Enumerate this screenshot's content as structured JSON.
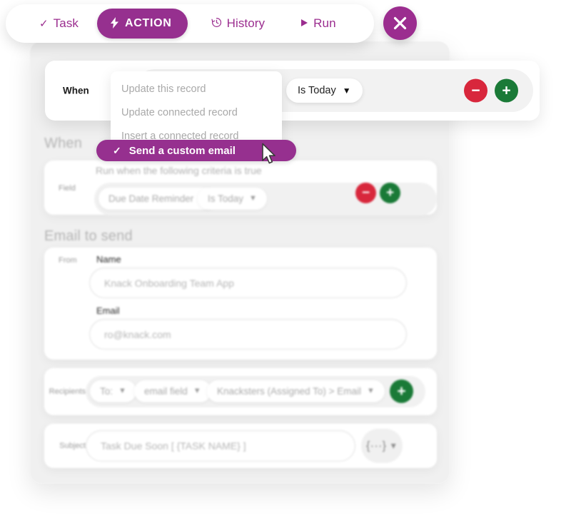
{
  "tabs": [
    {
      "label": "Task",
      "icon": "check-icon",
      "glyph": "✓",
      "active": false
    },
    {
      "label": "ACTION",
      "icon": "bolt-icon",
      "glyph": "⚡",
      "active": true
    },
    {
      "label": "History",
      "icon": "clock-icon",
      "glyph": "↺",
      "active": false
    },
    {
      "label": "Run",
      "icon": "play-icon",
      "glyph": "▶",
      "active": false
    }
  ],
  "close_button": {
    "icon": "close-icon",
    "label": "×"
  },
  "when_card": {
    "label": "When",
    "condition_pill": {
      "label": "Is Today",
      "icon": "chevron-down-icon",
      "caret": "▼"
    },
    "remove_button": {
      "icon": "minus-circle-icon",
      "glyph": "−",
      "color": "#d8273c"
    },
    "add_button": {
      "icon": "plus-circle-icon",
      "glyph": "+",
      "color": "#1a7a37"
    }
  },
  "dropdown": {
    "items": [
      {
        "label": "Update this record",
        "selected": false
      },
      {
        "label": "Update connected record",
        "selected": false
      },
      {
        "label": "Insert a connected record",
        "selected": false
      }
    ],
    "selected_item": {
      "label": "Send a custom email",
      "icon": "check-icon",
      "glyph": "✓"
    }
  },
  "when_section": {
    "title": "When",
    "field_label": "Field",
    "helper_text": "Run when the following criteria is true",
    "field_pill": {
      "label": "Due Date Reminder",
      "caret": "▼"
    },
    "operator_pill": {
      "label": "Is Today",
      "caret": "▼"
    },
    "remove_button": {
      "icon": "minus-circle-icon",
      "glyph": "−"
    },
    "add_button": {
      "icon": "plus-circle-icon",
      "glyph": "+"
    }
  },
  "email_section": {
    "title": "Email to send",
    "from_label": "From",
    "name_label": "Name",
    "name_placeholder": "Knack Onboarding Team App",
    "email_label": "Email",
    "email_placeholder": "ro@knack.com"
  },
  "recipients_section": {
    "label": "Recipients",
    "to_pill": {
      "label": "To:",
      "caret": "▼"
    },
    "type_pill": {
      "label": "email field",
      "caret": "▼"
    },
    "source_pill": {
      "label": "Knacksters (Assigned To) > Email",
      "caret": "▼"
    },
    "add_button": {
      "icon": "plus-circle-icon",
      "glyph": "+"
    }
  },
  "subject_section": {
    "label": "Subject",
    "placeholder": "Task Due Soon [ {TASK NAME} ]",
    "merge_button": {
      "icon": "merge-field-icon",
      "glyph": "{···}",
      "caret": "▼"
    }
  },
  "theme": {
    "accent": "#96308F",
    "danger": "#d8273c",
    "success": "#1a7a37"
  }
}
